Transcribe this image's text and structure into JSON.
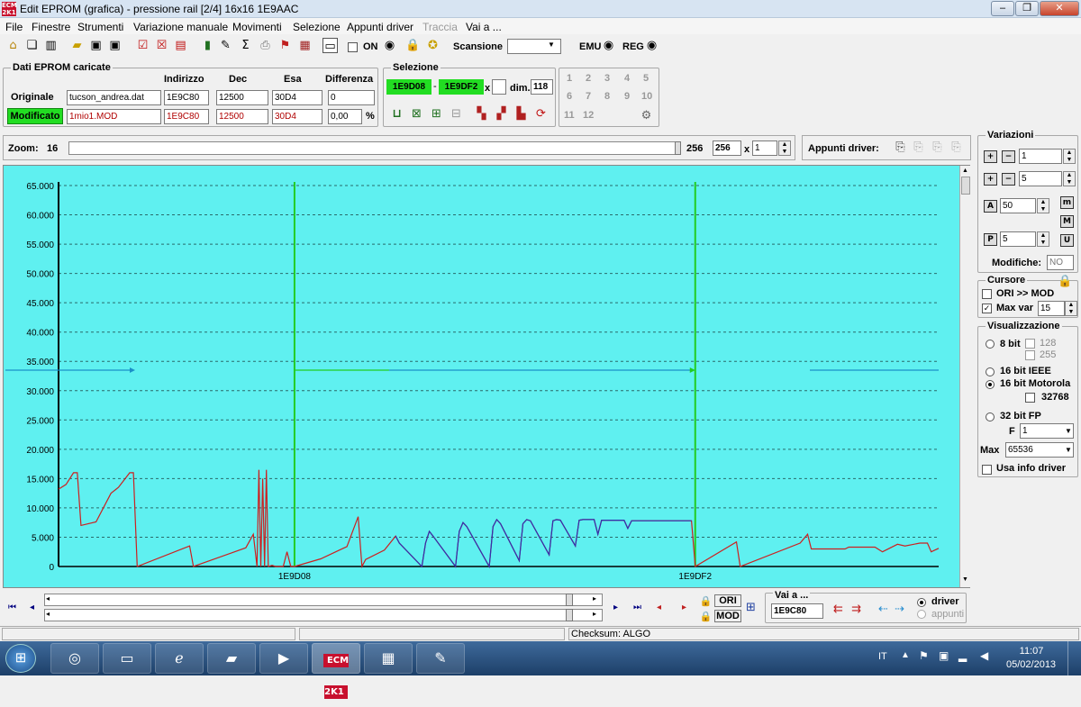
{
  "window": {
    "title": "Edit EPROM (grafica) - pressione rail  [2/4]  16x16  1E9AAC",
    "app_icon_text": "ECM 2K1",
    "controls": [
      "–",
      "❐",
      "✕"
    ]
  },
  "menu": [
    "File",
    "Finestre",
    "Strumenti",
    "Variazione manuale",
    "Movimenti",
    "Selezione",
    "Appunti driver",
    "Traccia",
    "Vai a ..."
  ],
  "toolbar": {
    "on_label": "ON",
    "scansione_label": "Scansione",
    "emu_label": "EMU",
    "reg_label": "REG"
  },
  "dati": {
    "legend": "Dati EPROM caricate",
    "headers": [
      "Indirizzo",
      "Dec",
      "Esa",
      "Differenza"
    ],
    "originale": {
      "label": "Originale",
      "file": "tucson_andrea.dat",
      "indirizzo": "1E9C80",
      "dec": "12500",
      "esa": "30D4",
      "diff": "0"
    },
    "modificato": {
      "label": "Modificato",
      "file": "1mio1.MOD",
      "indirizzo": "1E9C80",
      "dec": "12500",
      "esa": "30D4",
      "diff": "0,00",
      "unit": "%"
    }
  },
  "selezione": {
    "legend": "Selezione",
    "start": "1E9D08",
    "sep": "-",
    "end": "1E9DF2",
    "x_label": "x",
    "dim_label": "dim.",
    "dim": "118"
  },
  "numbuttons": [
    "1",
    "2",
    "3",
    "4",
    "5",
    "6",
    "7",
    "8",
    "9",
    "10",
    "11",
    "12"
  ],
  "zoom": {
    "label": "Zoom:",
    "min": "16",
    "max": "256",
    "value": "256",
    "x_label": "x",
    "mult": "1"
  },
  "appunti": {
    "label": "Appunti driver:"
  },
  "variazioni": {
    "legend": "Variazioni",
    "v1": "1",
    "v2": "5",
    "a": "50",
    "p": "5",
    "modifiche_label": "Modifiche:",
    "modifiche": "NO",
    "btn_a": "A",
    "btn_p": "P",
    "btn_m": "m",
    "btn_M": "M",
    "btn_U": "U"
  },
  "cursore": {
    "legend": "Cursore",
    "ori_mod": "ORI >> MOD",
    "max_var_label": "Max var",
    "max_var": "15"
  },
  "visualizzazione": {
    "legend": "Visualizzazione",
    "bit8": "8 bit",
    "v128": "128",
    "v255": "255",
    "ieee": "16 bit IEEE",
    "motorola": "16 bit Motorola",
    "v32768": "32768",
    "fp32": "32 bit FP",
    "f_label": "F",
    "f_value": "1",
    "max_label": "Max",
    "max_value": "65536",
    "info_driver": "Usa info driver"
  },
  "bottom": {
    "ori": "ORI",
    "mod": "MOD",
    "vai_label": "Vai a ...",
    "vai_value": "1E9C80",
    "driver": "driver",
    "appunti": "appunti"
  },
  "status": {
    "checksum": "Checksum: ALGO"
  },
  "taskbar": {
    "lang": "IT",
    "time": "11:07",
    "date": "05/02/2013"
  },
  "colors": {
    "chart_bg": "#5ff0f0",
    "grid": "#2a6b6b",
    "ori_line": "#cc2020",
    "mod_line": "#3030b0",
    "marker": "#22cc22",
    "arrow": "#1a8fc8",
    "selection_green": "#22dd22"
  },
  "chart_data": {
    "type": "line",
    "ylim": [
      0,
      65000
    ],
    "yticks": [
      "0",
      "5.000",
      "10.000",
      "15.000",
      "20.000",
      "25.000",
      "30.000",
      "35.000",
      "40.000",
      "45.000",
      "50.000",
      "55.000",
      "60.000",
      "65.000"
    ],
    "xlim": [
      0,
      235
    ],
    "x_markers": [
      {
        "x": 63,
        "label": "1E9D08"
      },
      {
        "x": 170,
        "label": "1E9DF2"
      }
    ],
    "cursor_arrow_value": 33500,
    "series": [
      {
        "key": "ori",
        "values": [
          [
            0,
            13200
          ],
          [
            2,
            14000
          ],
          [
            4,
            16000
          ],
          [
            5,
            16000
          ],
          [
            6,
            7000
          ],
          [
            10,
            7600
          ],
          [
            14,
            12500
          ],
          [
            16,
            13500
          ],
          [
            19,
            16000
          ],
          [
            20,
            16000
          ],
          [
            21,
            0
          ],
          [
            35,
            3500
          ],
          [
            36,
            0
          ],
          [
            50,
            3200
          ],
          [
            52,
            5500
          ],
          [
            53,
            0
          ],
          [
            53.5,
            16500
          ],
          [
            54,
            0
          ],
          [
            54.5,
            15000
          ],
          [
            55,
            0
          ],
          [
            55.5,
            16500
          ],
          [
            56,
            0
          ],
          [
            57,
            200
          ],
          [
            58,
            0
          ],
          [
            60,
            0
          ],
          [
            61,
            2500
          ],
          [
            62,
            0
          ],
          [
            63,
            0
          ],
          [
            70,
            1300
          ],
          [
            77,
            3400
          ],
          [
            80,
            8500
          ],
          [
            81,
            0
          ],
          [
            82,
            1200
          ],
          [
            87,
            2800
          ],
          [
            90,
            5200
          ],
          [
            91,
            4000
          ],
          [
            97,
            0
          ],
          [
            98,
            4000
          ],
          [
            99,
            6000
          ],
          [
            100,
            5200
          ],
          [
            106,
            0
          ],
          [
            107,
            6000
          ],
          [
            108,
            7500
          ],
          [
            109,
            6800
          ],
          [
            115,
            0
          ],
          [
            116,
            6800
          ],
          [
            117,
            8000
          ],
          [
            118,
            7300
          ],
          [
            123,
            1000
          ],
          [
            124,
            7300
          ],
          [
            125,
            8000
          ],
          [
            126,
            7800
          ],
          [
            131,
            2000
          ],
          [
            132,
            7800
          ],
          [
            133,
            8000
          ],
          [
            134,
            7900
          ],
          [
            138,
            3500
          ],
          [
            139,
            7900
          ],
          [
            140,
            8000
          ],
          [
            143,
            8000
          ],
          [
            144,
            5500
          ],
          [
            145,
            7900
          ],
          [
            151,
            7900
          ],
          [
            152,
            6500
          ],
          [
            153,
            7800
          ],
          [
            169,
            7800
          ],
          [
            170,
            0
          ],
          [
            181,
            4200
          ],
          [
            182,
            0
          ],
          [
            198,
            4000
          ],
          [
            200,
            5500
          ],
          [
            201,
            3000
          ],
          [
            210,
            3000
          ],
          [
            211,
            3300
          ],
          [
            218,
            3300
          ],
          [
            220,
            2500
          ],
          [
            224,
            3800
          ],
          [
            226,
            3500
          ],
          [
            230,
            4000
          ],
          [
            232,
            4000
          ],
          [
            233,
            2500
          ],
          [
            235,
            3100
          ]
        ]
      },
      {
        "key": "mod",
        "values": [
          [
            90,
            5200
          ],
          [
            91,
            4000
          ],
          [
            97,
            0
          ],
          [
            98,
            4000
          ],
          [
            99,
            6000
          ],
          [
            100,
            5200
          ],
          [
            106,
            0
          ],
          [
            107,
            6000
          ],
          [
            108,
            7500
          ],
          [
            109,
            6800
          ],
          [
            115,
            0
          ],
          [
            116,
            6800
          ],
          [
            117,
            8000
          ],
          [
            118,
            7300
          ],
          [
            123,
            1000
          ],
          [
            124,
            7300
          ],
          [
            125,
            8000
          ],
          [
            126,
            7800
          ],
          [
            131,
            2000
          ],
          [
            132,
            7800
          ],
          [
            133,
            8000
          ],
          [
            134,
            7900
          ],
          [
            138,
            3500
          ],
          [
            139,
            7900
          ],
          [
            140,
            8000
          ],
          [
            143,
            8000
          ],
          [
            144,
            5500
          ],
          [
            145,
            7900
          ],
          [
            151,
            7900
          ],
          [
            152,
            6500
          ],
          [
            153,
            7800
          ],
          [
            169,
            7800
          ]
        ]
      }
    ]
  }
}
